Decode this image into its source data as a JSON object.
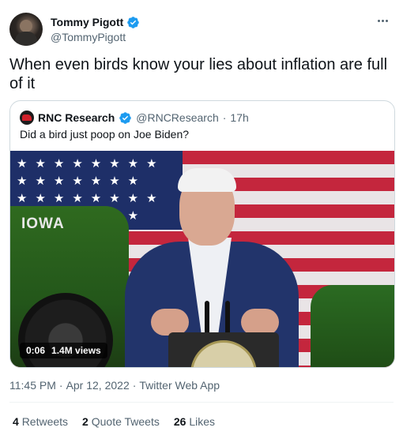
{
  "author": {
    "display_name": "Tommy Pigott",
    "handle": "@TommyPigott",
    "verified_icon": "verified-badge-icon"
  },
  "tweet": {
    "text": "When even birds know your lies about inflation are full of it"
  },
  "quoted_tweet": {
    "display_name": "RNC Research",
    "handle": "@RNCResearch",
    "separator": "·",
    "age": "17h",
    "text": "Did a bird just poop on Joe Biden?",
    "video": {
      "duration": "0:06",
      "views": "1.4M views",
      "banner_text": "IOWA"
    }
  },
  "meta": {
    "time": "11:45 PM",
    "sep1": "·",
    "date": "Apr 12, 2022",
    "sep2": "·",
    "source": "Twitter Web App"
  },
  "stats": {
    "retweets_count": "4",
    "retweets_label": "Retweets",
    "quotes_count": "2",
    "quotes_label": "Quote Tweets",
    "likes_count": "26",
    "likes_label": "Likes"
  },
  "colors": {
    "verified": "#1d9bf0",
    "text": "#0f1419",
    "secondary": "#536471",
    "border": "#cfd9de"
  }
}
